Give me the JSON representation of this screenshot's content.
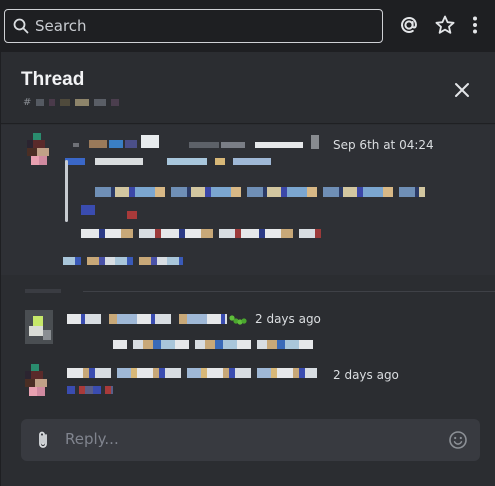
{
  "search": {
    "placeholder": "Search"
  },
  "topbar": {
    "mentions_icon": "at-icon",
    "pins_icon": "star-icon",
    "more_icon": "more-vertical-icon"
  },
  "thread": {
    "title": "Thread",
    "channel_prefix": "#",
    "close_icon": "close-icon"
  },
  "messages": [
    {
      "time": "Sep 6th at 04:24"
    },
    {
      "time": "2 days ago",
      "badge_icon": "caterpillar-icon"
    },
    {
      "time": "2 days ago"
    }
  ],
  "composer": {
    "placeholder": "Reply...",
    "attach_icon": "paperclip-icon",
    "emoji_icon": "smiley-icon"
  },
  "colors": {
    "background": "#2b2d31",
    "topbar": "#1e1f22",
    "composer": "#383a40"
  }
}
